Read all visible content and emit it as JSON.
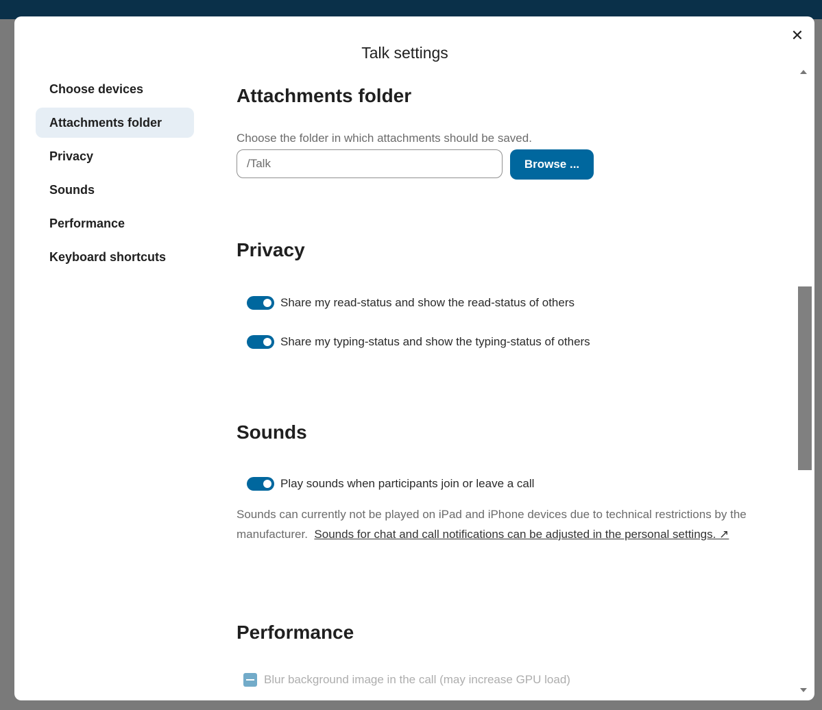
{
  "dialog": {
    "title": "Talk settings",
    "close_icon": "close-icon"
  },
  "nav": {
    "items": [
      {
        "label": "Choose devices"
      },
      {
        "label": "Attachments folder"
      },
      {
        "label": "Privacy"
      },
      {
        "label": "Sounds"
      },
      {
        "label": "Performance"
      },
      {
        "label": "Keyboard shortcuts"
      }
    ],
    "active": "Attachments folder"
  },
  "attachments": {
    "title": "Attachments folder",
    "hint": "Choose the folder in which attachments should be saved.",
    "folder_value": "/Talk",
    "browse_label": "Browse ..."
  },
  "privacy": {
    "title": "Privacy",
    "read_status": {
      "label": "Share my read-status and show the read-status of others",
      "enabled": true
    },
    "typing_status": {
      "label": "Share my typing-status and show the typing-status of others",
      "enabled": true
    }
  },
  "sounds": {
    "title": "Sounds",
    "play_sounds": {
      "label": "Play sounds when participants join or leave a call",
      "enabled": true
    },
    "note": "Sounds can currently not be played on iPad and iPhone devices due to technical restrictions by the manufacturer.",
    "link": "Sounds for chat and call notifications can be adjusted in the personal settings. ↗"
  },
  "performance": {
    "title": "Performance",
    "blur": {
      "label": "Blur background image in the call (may increase GPU load)",
      "state": "indeterminate",
      "disabled": true
    }
  },
  "colors": {
    "accent": "#00679e",
    "header": "#0a3049",
    "active_nav_bg": "#e6eef5"
  }
}
